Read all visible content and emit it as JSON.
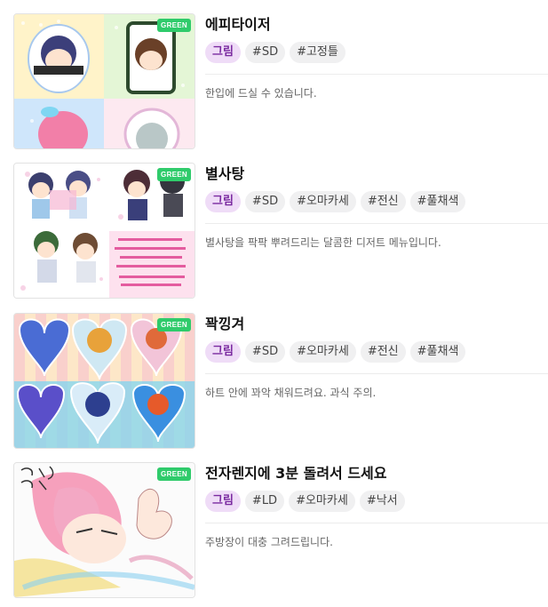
{
  "items": [
    {
      "title": "에피타이저",
      "badge": "GREEN",
      "thumbnail_alt": "에피타이저 샘플 이미지",
      "tags": [
        "그림",
        "#SD",
        "#고정틀"
      ],
      "description": "한입에 드실 수 있습니다."
    },
    {
      "title": "별사탕",
      "badge": "GREEN",
      "thumbnail_alt": "별사탕 샘플 이미지",
      "tags": [
        "그림",
        "#SD",
        "#오마카세",
        "#전신",
        "#풀채색"
      ],
      "description": "별사탕을 팍팍 뿌려드리는 달콤한 디저트 메뉴입니다."
    },
    {
      "title": "꽉낑겨",
      "badge": "GREEN",
      "thumbnail_alt": "꽉낑겨 샘플 이미지",
      "tags": [
        "그림",
        "#SD",
        "#오마카세",
        "#전신",
        "#풀채색"
      ],
      "description": "하트 안에 꽈악 채워드려요. 과식 주의."
    },
    {
      "title": "전자렌지에 3분 돌려서 드세요",
      "badge": "GREEN",
      "thumbnail_alt": "전자렌지에 3분 돌려서 드세요 샘플 이미지",
      "tags": [
        "그림",
        "#LD",
        "#오마카세",
        "#낙서"
      ],
      "description": "주방장이 대충 그려드립니다."
    }
  ],
  "colors": {
    "badge_green": "#2fcb6b",
    "primary_tag_bg": "#efdcf7",
    "primary_tag_text": "#7a2aa0",
    "tag_bg": "#f0f0f1"
  }
}
